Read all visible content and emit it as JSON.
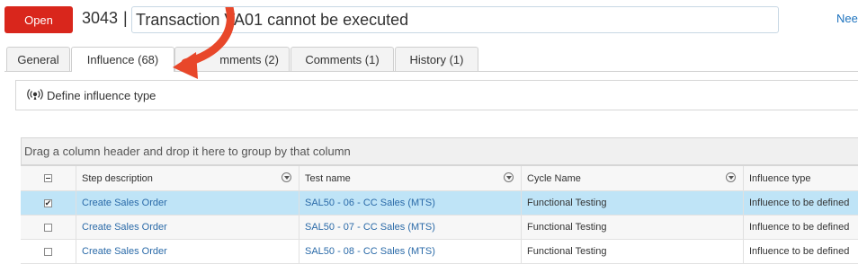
{
  "header": {
    "open_button": "Open",
    "ticket_id": "3043",
    "separator": "|",
    "title_value": "Transaction VA01 cannot be executed",
    "need_link": "Nee"
  },
  "tabs": [
    {
      "label": "General"
    },
    {
      "label": "Influence (68)"
    },
    {
      "label": "mments (2)"
    },
    {
      "label": "Comments (1)"
    },
    {
      "label": "History (1)"
    }
  ],
  "influence_bar": {
    "label": "Define influence type",
    "icon": "broadcast-icon"
  },
  "grid": {
    "group_hint": "Drag a column header and drop it here to group by that column",
    "columns": [
      "Step description",
      "Test name",
      "Cycle Name",
      "Influence type"
    ],
    "rows": [
      {
        "checked": true,
        "step": "Create Sales Order",
        "test": "SAL50 - 06 - CC Sales (MTS)",
        "cycle": "Functional Testing",
        "influence": "Influence to be defined"
      },
      {
        "checked": false,
        "step": "Create Sales Order",
        "test": "SAL50 - 07 - CC Sales (MTS)",
        "cycle": "Functional Testing",
        "influence": "Influence to be defined"
      },
      {
        "checked": false,
        "step": "Create Sales Order",
        "test": "SAL50 - 08 - CC Sales (MTS)",
        "cycle": "Functional Testing",
        "influence": "Influence to be defined"
      }
    ]
  },
  "colors": {
    "open_button": "#d9261c",
    "selected_row": "#bfe4f7",
    "link": "#2a6aa8",
    "arrow": "#e8472a"
  }
}
